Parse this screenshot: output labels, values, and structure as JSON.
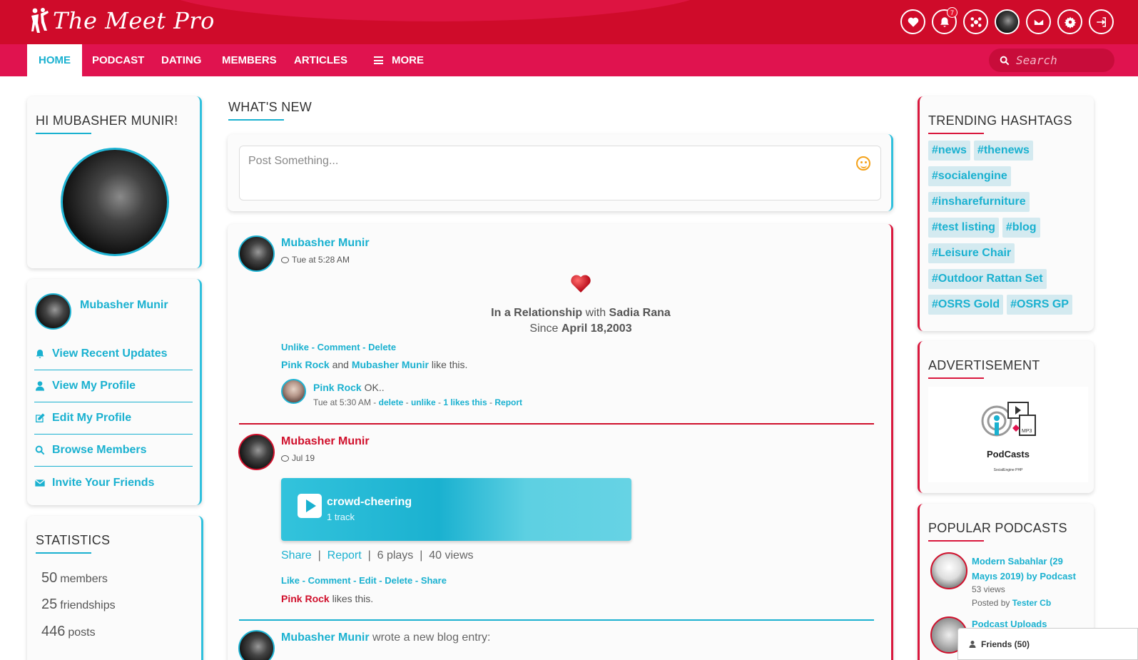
{
  "brand": {
    "name": "The Meet Pro"
  },
  "header": {
    "notification_count": "7"
  },
  "nav": {
    "items": [
      "HOME",
      "PODCAST",
      "DATING",
      "MEMBERS",
      "ARTICLES"
    ],
    "more_label": "MORE",
    "search_placeholder": "Search"
  },
  "profile_card": {
    "greeting": "HI MUBASHER MUNIR!"
  },
  "quick_links": {
    "user_name": "Mubasher Munir",
    "links": [
      "View Recent Updates",
      "View My Profile",
      "Edit My Profile",
      "Browse Members",
      "Invite Your Friends"
    ]
  },
  "statistics": {
    "title": "STATISTICS",
    "rows": [
      {
        "value": "50",
        "label": "members"
      },
      {
        "value": "25",
        "label": "friendships"
      },
      {
        "value": "446",
        "label": "posts"
      }
    ]
  },
  "feed": {
    "title": "WHAT'S NEW",
    "composer_placeholder": "Post Something...",
    "post1": {
      "author": "Mubasher Munir",
      "time": "Tue at 5:28 AM",
      "status_prefix": "In a Relationship",
      "status_with": "with",
      "partner": "Sadia Rana",
      "since_label": "Since",
      "since_date": "April 18,2003",
      "actions": [
        "Unlike",
        "Comment",
        "Delete"
      ],
      "likers": [
        "Pink Rock",
        "Mubasher Munir"
      ],
      "likers_and": "and",
      "likers_suffix": "like this.",
      "comment": {
        "author": "Pink Rock",
        "text": "OK..",
        "time": "Tue at 5:30 AM",
        "actions": [
          "delete",
          "unlike",
          "1 likes this",
          "Report"
        ]
      }
    },
    "post2": {
      "author": "Mubasher Munir",
      "time": "Jul 19",
      "track_title": "crowd-cheering",
      "track_count": "1 track",
      "share": "Share",
      "report": "Report",
      "plays": "6 plays",
      "views": "40 views",
      "actions": [
        "Like",
        "Comment",
        "Edit",
        "Delete",
        "Share"
      ],
      "liker": "Pink Rock",
      "liker_suffix": "likes this."
    },
    "post3": {
      "author": "Mubasher Munir",
      "text": "wrote a new blog entry:"
    }
  },
  "trending": {
    "title": "TRENDING HASHTAGS",
    "tags": [
      "#news",
      "#thenews",
      "#socialengine",
      "#insharefurniture",
      "#test listing",
      "#blog",
      "#Leisure Chair",
      "#Outdoor Rattan Set",
      "#OSRS Gold",
      "#OSRS GP"
    ]
  },
  "advertisement": {
    "title": "ADVERTISEMENT",
    "label": "PodCasts",
    "sub": "SocialEngine PHP"
  },
  "podcasts": {
    "title": "POPULAR PODCASTS",
    "item1": {
      "title": "Modern Sabahlar (29 Mayıs 2019) by Podcast",
      "views": "53 views",
      "posted_by": "Posted by",
      "poster": "Tester Cb"
    },
    "item2": {
      "title": "Podcast Uploads"
    }
  },
  "friends_bar": {
    "label": "Friends (50)"
  },
  "colors": {
    "primary_red": "#cf0b2a",
    "nav_pink": "#e0134f",
    "accent_blue": "#1ab1d0"
  }
}
